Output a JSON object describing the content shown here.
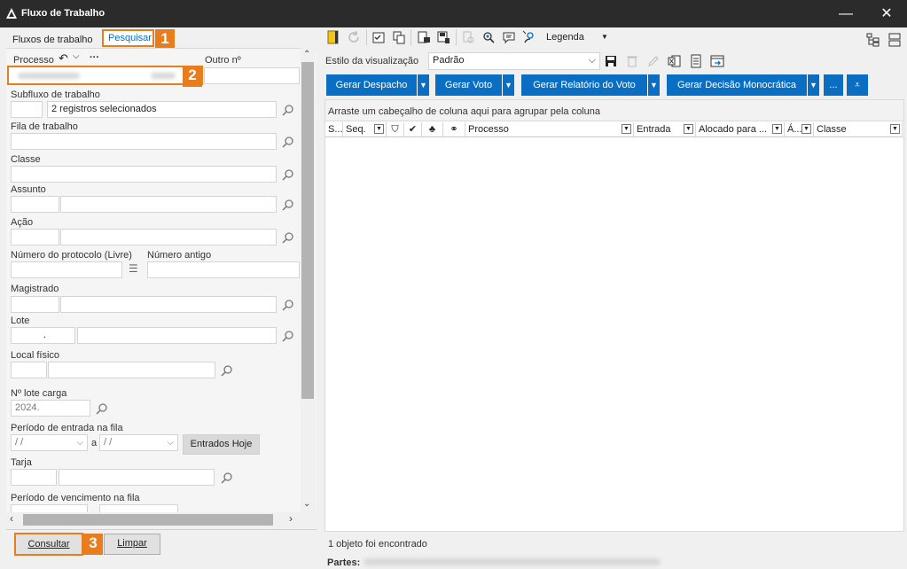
{
  "window": {
    "title": "Fluxo de Trabalho",
    "minimize": "—",
    "close": "✕"
  },
  "left": {
    "tabs": [
      "Fluxos de trabalho",
      "Pesquisar"
    ],
    "badges": [
      "1",
      "2",
      "3"
    ],
    "labels": {
      "processo": "Processo",
      "outro_no": "Outro nº",
      "subfluxo": "Subfluxo de trabalho",
      "fila": "Fila de trabalho",
      "classe": "Classe",
      "assunto": "Assunto",
      "acao": "Ação",
      "num_protocolo": "Número do protocolo (Livre)",
      "num_antigo": "Número antigo",
      "magistrado": "Magistrado",
      "lote": "Lote",
      "local_fisico": "Local físico",
      "lote_carga": "Nº lote carga",
      "periodo_entrada": "Período de entrada na fila",
      "tarja": "Tarja",
      "periodo_vencimento": "Período de vencimento na fila"
    },
    "values": {
      "subfluxo": "2 registros selecionados",
      "lote_dot": ".",
      "lote_carga": "2024.",
      "date_placeholder": "/ /",
      "date_sep": "a"
    },
    "buttons": {
      "entrados_hoje": "Entrados Hoje",
      "consultar": "Consultar",
      "limpar": "Limpar"
    }
  },
  "right": {
    "toolbar": {
      "legenda": "Legenda"
    },
    "style_label": "Estilo da visualização",
    "style_value": "Padrão",
    "action_buttons": [
      "Gerar Despacho",
      "Gerar Voto",
      "Gerar Relatório do Voto",
      "Gerar Decisão Monocrática",
      "..."
    ],
    "group_hint": "Arraste um cabeçalho de coluna aqui para agrupar pela coluna",
    "columns": [
      "S...",
      "Seq.",
      "Processo",
      "Entrada",
      "Alocado para ...",
      "Á...",
      "Classe"
    ],
    "status": "1 objeto foi encontrado",
    "partes_label": "Partes:"
  },
  "colors": {
    "accent": "#e87d1e",
    "blue": "#0a6fc2",
    "titlebar": "#2b2b2b"
  }
}
